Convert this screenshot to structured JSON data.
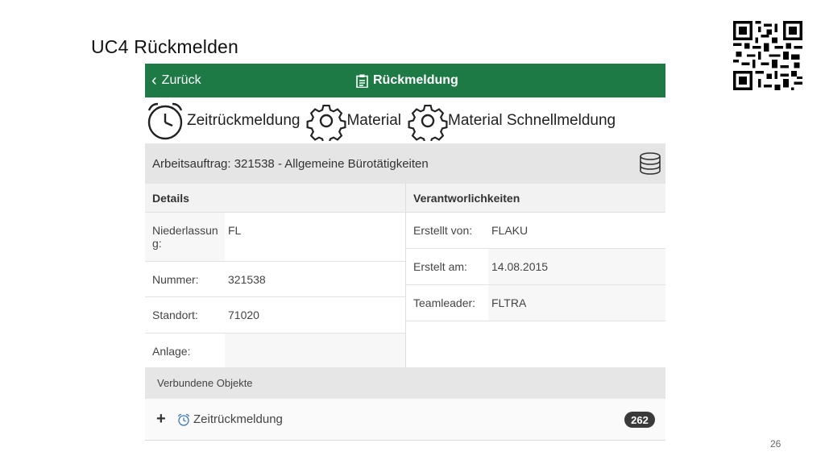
{
  "slide": {
    "title": "UC4 Rückmelden",
    "page_number": "26"
  },
  "topbar": {
    "back_label": "Zurück",
    "title": "Rückmeldung",
    "color": "#1d7a45"
  },
  "tabs": [
    {
      "label": "Zeitrückmeldung",
      "icon": "alarm-clock-icon"
    },
    {
      "label": "Material",
      "icon": "gear-icon"
    },
    {
      "label": "Material Schnellmeldung",
      "icon": "gear-icon"
    }
  ],
  "order": {
    "text": "Arbeitsauftrag: 321538 - Allgemeine Bürotätigkeiten",
    "icon": "database-icon"
  },
  "details": {
    "heading": "Details",
    "rows": [
      {
        "key": "Niederlassun g:",
        "value": "FL"
      },
      {
        "key": "Nummer:",
        "value": "321538"
      },
      {
        "key": "Standort:",
        "value": "71020"
      },
      {
        "key": "Anlage:",
        "value": ""
      }
    ]
  },
  "responsibilities": {
    "heading": "Verantworlichkeiten",
    "rows": [
      {
        "key": "Erstellt von:",
        "value": "FLAKU"
      },
      {
        "key": "Erstelt am:",
        "value": "14.08.2015"
      },
      {
        "key": "Teamleader:",
        "value": "FLTRA"
      }
    ]
  },
  "linked": {
    "heading": "Verbundene Objekte",
    "item_label": "Zeitrückmeldung",
    "item_icon": "alarm-clock-icon",
    "count": "262"
  }
}
